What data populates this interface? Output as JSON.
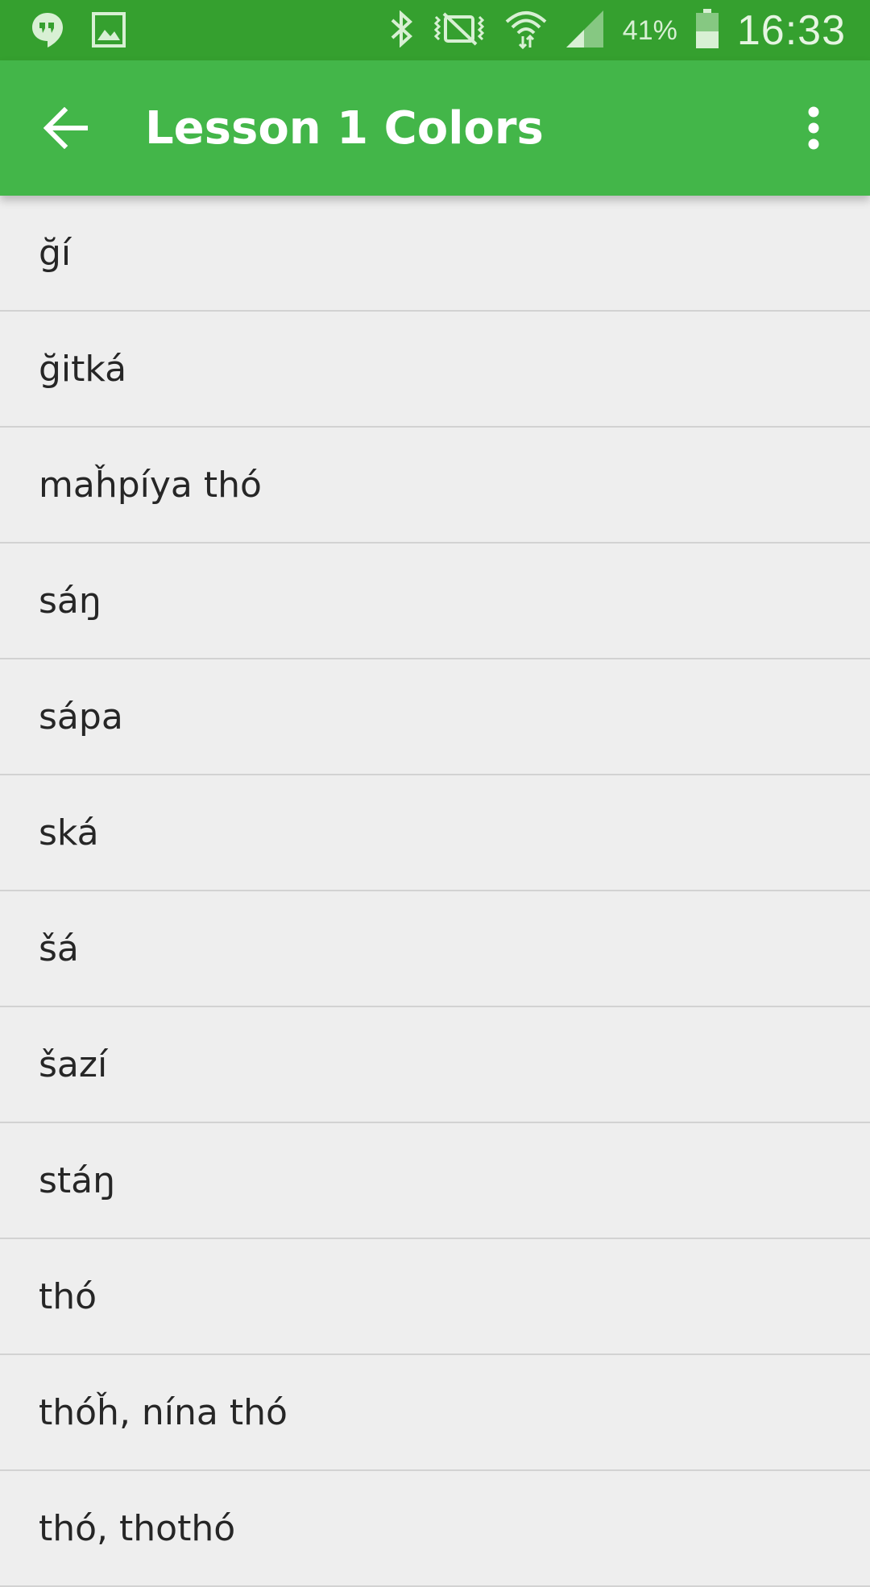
{
  "status_bar": {
    "battery": "41%",
    "time": "16:33",
    "icons": [
      "hangouts-icon",
      "gallery-icon",
      "bluetooth-icon",
      "vibrate-mute-icon",
      "wifi-icon",
      "signal-icon",
      "battery-icon"
    ]
  },
  "app_bar": {
    "title": "Lesson 1 Colors",
    "back_icon": "arrow-back-icon",
    "overflow_icon": "more-vert-icon",
    "color": "#43b649"
  },
  "words": [
    {
      "label": "ğí"
    },
    {
      "label": "ğitká"
    },
    {
      "label": "maȟpíya thó"
    },
    {
      "label": "sáŋ"
    },
    {
      "label": "sápa"
    },
    {
      "label": "ská"
    },
    {
      "label": "šá"
    },
    {
      "label": "šazí"
    },
    {
      "label": "stáŋ"
    },
    {
      "label": "thó"
    },
    {
      "label": "thóȟ, nína thó"
    },
    {
      "label": "thó, thothó"
    }
  ]
}
